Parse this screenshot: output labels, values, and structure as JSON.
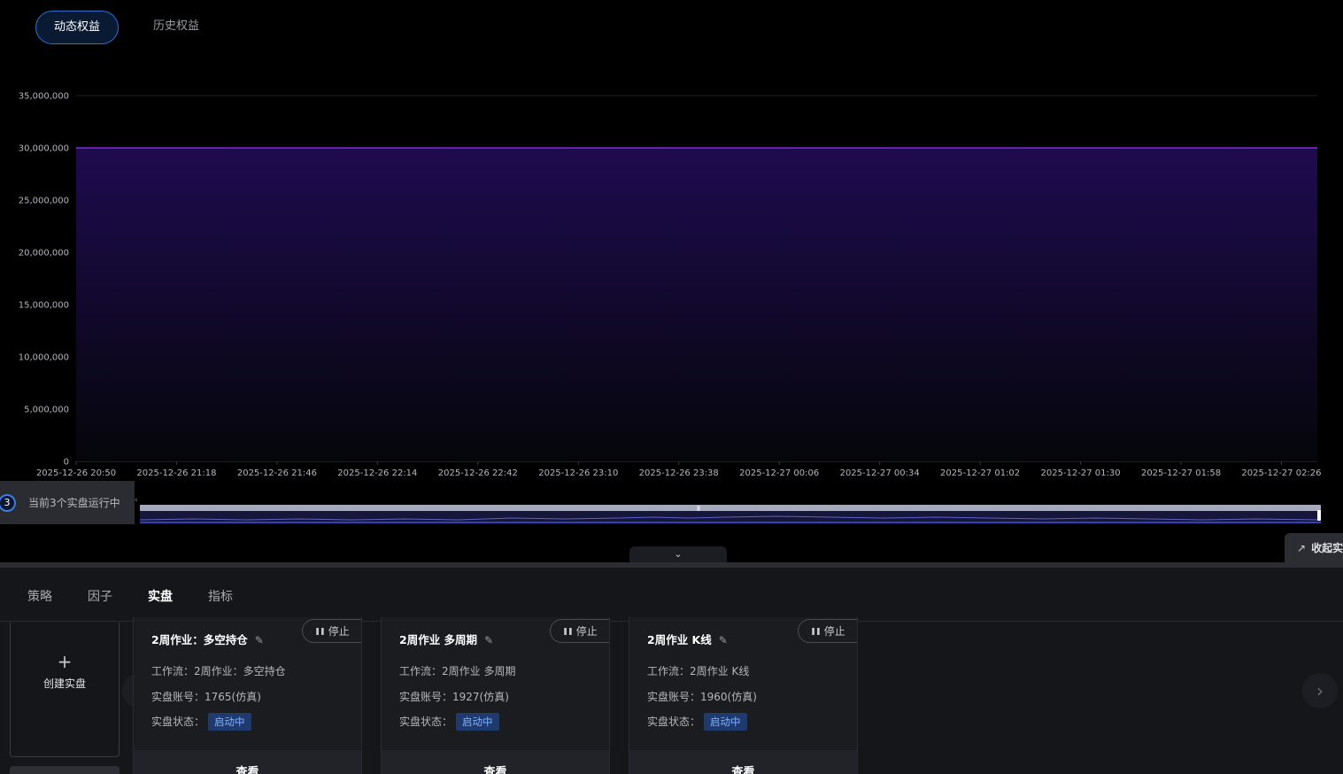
{
  "top_tabs": {
    "active": "动态权益",
    "inactive": "历史权益"
  },
  "chart_data": {
    "type": "area",
    "y_ticks": [
      "35,000,000",
      "30,000,000",
      "25,000,000",
      "20,000,000",
      "15,000,000",
      "10,000,000",
      "5,000,000",
      "0"
    ],
    "ylim": [
      0,
      35000000
    ],
    "x_ticks": [
      "2025-12-26 20:50",
      "2025-12-26 21:18",
      "2025-12-26 21:46",
      "2025-12-26 22:14",
      "2025-12-26 22:42",
      "2025-12-26 23:10",
      "2025-12-26 23:38",
      "2025-12-27 00:06",
      "2025-12-27 00:34",
      "2025-12-27 01:02",
      "2025-12-27 01:30",
      "2025-12-27 01:58",
      "2025-12-27 02:26"
    ],
    "xlim": [
      "2025-12-26 20:50",
      "2025-12-27 02:36"
    ],
    "series": [
      {
        "x": [
          "2025-12-26 20:50",
          "2025-12-27 02:36"
        ],
        "values": [
          30000000,
          30000000
        ]
      }
    ],
    "grid": true,
    "line_color": "#7b2fd6",
    "fill_top": "#1e0b4f",
    "fill_bottom": "#05060a"
  },
  "running": {
    "count": "3",
    "label": "当前3个实盘运行中"
  },
  "side_button": {
    "label": "收起实",
    "icon": "chart-line-icon"
  },
  "bottom_tabs": [
    "策略",
    "因子",
    "实盘",
    "指标"
  ],
  "create_card": {
    "label": "创建实盘",
    "icon": "plus-icon"
  },
  "cards": [
    {
      "title": "2周作业：多空持仓",
      "stop": "停止",
      "workflow_label": "工作流：",
      "workflow": "2周作业：多空持仓",
      "account_label": "实盘账号：",
      "account": "1765(仿真)",
      "status_label": "实盘状态：",
      "status": "启动中",
      "view": "查看"
    },
    {
      "title": "2周作业 多周期",
      "stop": "停止",
      "workflow_label": "工作流：",
      "workflow": "2周作业 多周期",
      "account_label": "实盘账号：",
      "account": "1927(仿真)",
      "status_label": "实盘状态：",
      "status": "启动中",
      "view": "查看"
    },
    {
      "title": "2周作业 K线",
      "stop": "停止",
      "workflow_label": "工作流：",
      "workflow": "2周作业 K线",
      "account_label": "实盘账号：",
      "account": "1960(仿真)",
      "status_label": "实盘状态：",
      "status": "启动中",
      "view": "查看"
    }
  ],
  "colors": {
    "accent": "#3b82f6",
    "status_bg": "#1e3a6e",
    "status_text": "#7fb0ff"
  }
}
